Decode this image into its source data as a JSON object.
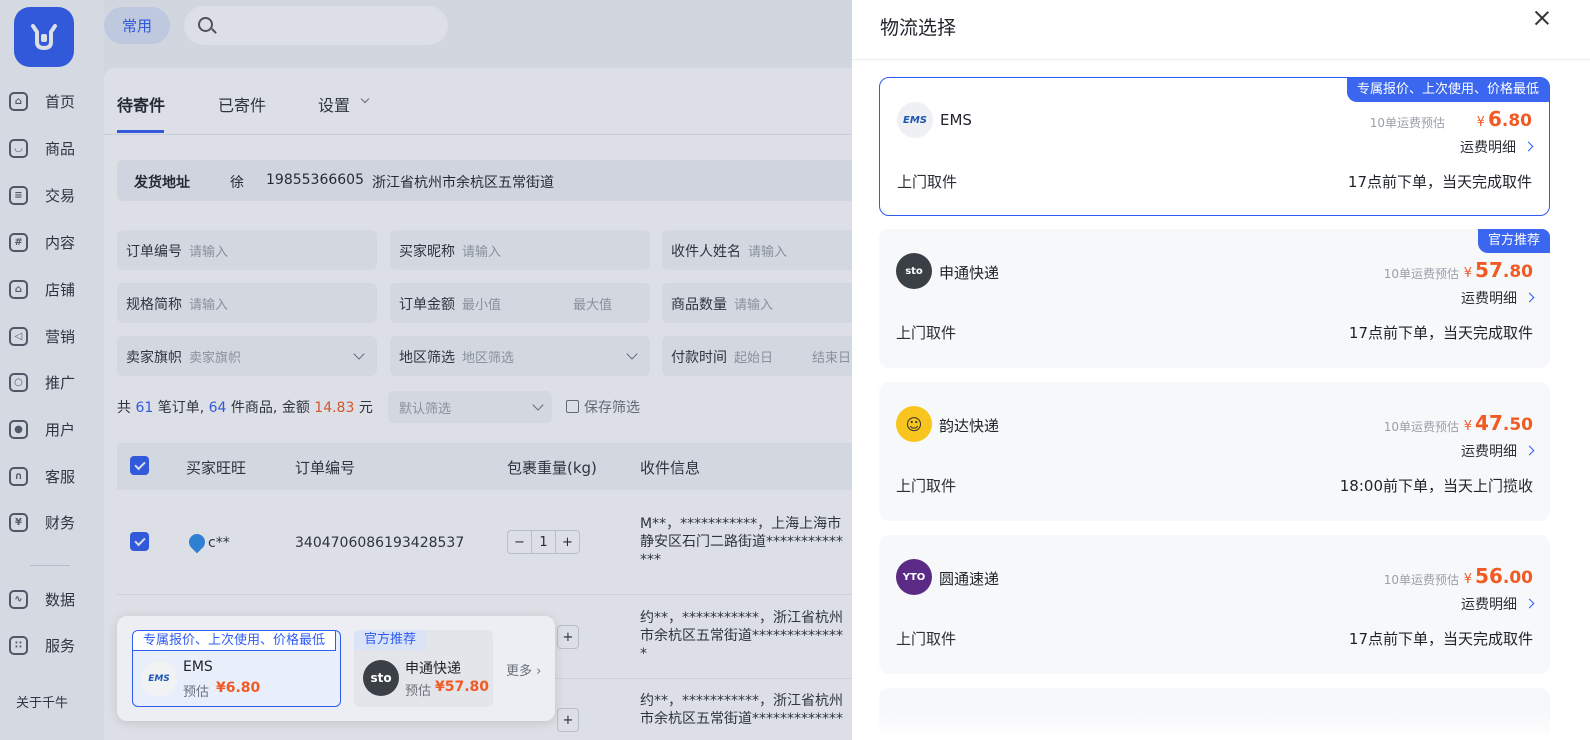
{
  "app": {
    "about": "关于千牛",
    "common_tab": "常用"
  },
  "sidebar": {
    "items": [
      {
        "label": "首页",
        "icon": "home-icon"
      },
      {
        "label": "商品",
        "icon": "goods-icon"
      },
      {
        "label": "交易",
        "icon": "trade-icon"
      },
      {
        "label": "内容",
        "icon": "hash-icon"
      },
      {
        "label": "店铺",
        "icon": "shop-icon"
      },
      {
        "label": "营销",
        "icon": "megaphone-icon"
      },
      {
        "label": "推广",
        "icon": "bulb-icon"
      },
      {
        "label": "用户",
        "icon": "user-icon"
      },
      {
        "label": "客服",
        "icon": "headset-icon"
      },
      {
        "label": "财务",
        "icon": "yen-icon"
      },
      {
        "label": "数据",
        "icon": "chart-icon"
      },
      {
        "label": "服务",
        "icon": "grid-icon"
      }
    ]
  },
  "tabs": {
    "pending": "待寄件",
    "sent": "已寄件",
    "settings": "设置"
  },
  "address": {
    "label": "发货地址",
    "name": "徐",
    "phone": "19855366605",
    "detail": "浙江省杭州市余杭区五常街道"
  },
  "filters": {
    "order_no": {
      "label": "订单编号",
      "placeholder": "请输入"
    },
    "buyer_nick": {
      "label": "买家昵称",
      "placeholder": "请输入"
    },
    "receiver": {
      "label": "收件人姓名",
      "placeholder": "请输入"
    },
    "spec": {
      "label": "规格简称",
      "placeholder": "请输入"
    },
    "amount": {
      "label": "订单金额",
      "min": "最小值",
      "max": "最大值"
    },
    "qty": {
      "label": "商品数量",
      "placeholder": "请输入"
    },
    "flag": {
      "label": "卖家旗帜",
      "placeholder": "卖家旗帜"
    },
    "region": {
      "label": "地区筛选",
      "placeholder": "地区筛选"
    },
    "paytime": {
      "label": "付款时间",
      "start": "起始日",
      "end": "结束日"
    }
  },
  "summary": {
    "p1": "共 ",
    "orders": "61",
    "p2": " 笔订单, ",
    "items": "64",
    "p3": " 件商品, 金额 ",
    "amount": "14.83",
    "p4": " 元"
  },
  "preset": {
    "placeholder": "默认筛选",
    "save": "保存筛选"
  },
  "table": {
    "headers": [
      "买家旺旺",
      "订单编号",
      "包裹重量(kg)",
      "收件信息"
    ],
    "row1": {
      "buyer": "c**",
      "order": "3404706086193428537",
      "qty": "1",
      "addr": [
        "M**，***********，上海上海市",
        "静安区石门二路街道***********",
        "***"
      ]
    },
    "row2": {
      "addr": [
        "约**，***********，浙江省杭州",
        "市余杭区五常街道*************",
        "*"
      ]
    },
    "row3": {
      "addr": [
        "约**，***********，浙江省杭州",
        "市余杭区五常街道*************"
      ]
    }
  },
  "popup": {
    "ems_tag": "专属报价、上次使用、价格最低",
    "ems_name": "EMS",
    "ems_est": "预估",
    "ems_price": "¥6.80",
    "sto_tag": "官方推荐",
    "sto_name": "申通快递",
    "sto_est": "预估",
    "sto_price": "¥57.80",
    "more": "更多"
  },
  "drawer": {
    "title": "物流选择",
    "cards": [
      {
        "tag": "专属报价、上次使用、价格最低",
        "name": "EMS",
        "logo": "EMS",
        "est": "10单运费预估",
        "yen": "¥",
        "int": "6",
        "dec": ".80",
        "detail": "运费明细",
        "pickup": "上门取件",
        "time": "17点前下单，当天完成取件",
        "color": "#eef0f4"
      },
      {
        "tag": "官方推荐",
        "name": "申通快递",
        "logo": "sto",
        "est": "10单运费预估",
        "yen": "¥",
        "int": "57",
        "dec": ".80",
        "detail": "运费明细",
        "pickup": "上门取件",
        "time": "17点前下单，当天完成取件",
        "color": "#3b3f46"
      },
      {
        "tag": "",
        "name": "韵达快递",
        "logo": "yunda",
        "est": "10单运费预估",
        "yen": "¥",
        "int": "47",
        "dec": ".50",
        "detail": "运费明细",
        "pickup": "上门取件",
        "time": "18:00前下单，当天上门揽收",
        "color": "#f7c51e"
      },
      {
        "tag": "",
        "name": "圆通速递",
        "logo": "YTO",
        "est": "10单运费预估",
        "yen": "¥",
        "int": "56",
        "dec": ".00",
        "detail": "运费明细",
        "pickup": "上门取件",
        "time": "17点前下单，当天完成取件",
        "color": "#5b2a86"
      }
    ]
  },
  "colors": {
    "accent": "#2f5cf2",
    "price": "#f25a23"
  }
}
